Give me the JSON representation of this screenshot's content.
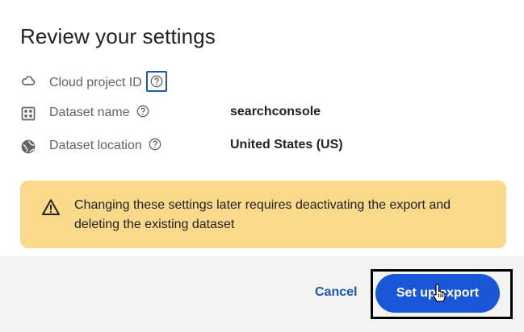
{
  "dialog": {
    "title": "Review your settings"
  },
  "settings": [
    {
      "icon": "cloud-icon",
      "label": "Cloud project ID",
      "value": ""
    },
    {
      "icon": "grid-icon",
      "label": "Dataset name",
      "value": "searchconsole"
    },
    {
      "icon": "globe-icon",
      "label": "Dataset location",
      "value": "United States (US)"
    }
  ],
  "warning": {
    "icon": "warning-triangle-icon",
    "text": "Changing these settings later requires deactivating the export and deleting the existing dataset"
  },
  "actions": {
    "cancel_label": "Cancel",
    "primary_label": "Set up export"
  },
  "colors": {
    "primary": "#1a56d8",
    "link": "#1a56b3",
    "warning_bg": "#fad98a"
  }
}
